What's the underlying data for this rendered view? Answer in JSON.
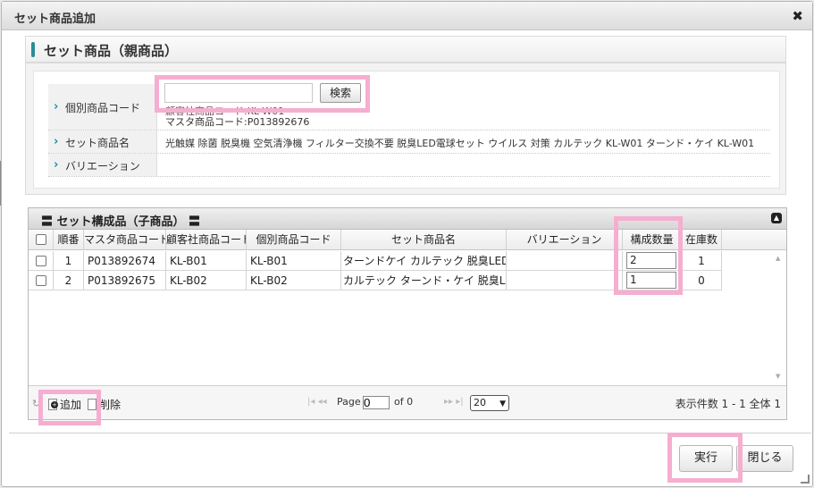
{
  "dialog": {
    "title": "セット商品追加",
    "close_glyph": "✖"
  },
  "parent": {
    "title": "セット商品（親商品）",
    "rows": [
      {
        "label": "個別商品コード",
        "value1": "顧客社商品コード:KL-W01",
        "value2": "マスタ商品コード:P013892676"
      },
      {
        "label": "セット商品名",
        "value": "光触媒 除菌 脱臭機 空気清浄機 フィルター交換不要 脱臭LED電球セット ウイルス 対策 カルテック KL-W01 ターンド・ケイ KL-W01"
      },
      {
        "label": "バリエーション",
        "value": ""
      }
    ],
    "search_button": "検索",
    "search_value": ""
  },
  "child": {
    "title": "〓 セット構成品（子商品） 〓",
    "columns": [
      "順番",
      "マスタ商品コード",
      "顧客社商品コード",
      "個別商品コード",
      "セット商品名",
      "バリエーション",
      "構成数量",
      "在庫数"
    ],
    "rows": [
      {
        "no": "1",
        "master": "P013892674",
        "customer": "KL-B01",
        "item": "KL-B01",
        "name": "ターンドケイ カルテック 脱臭LED電球",
        "variation": "",
        "qty": "2",
        "stock": "1"
      },
      {
        "no": "2",
        "master": "P013892675",
        "customer": "KL-B02",
        "item": "KL-B02",
        "name": "カルテック ターンド・ケイ 脱臭LED電球",
        "variation": "",
        "qty": "1",
        "stock": "0"
      }
    ],
    "pager": {
      "add_label": "追加",
      "delete_label": "削除",
      "page_label": "Page",
      "page_value": "0",
      "of_label": "of 0",
      "page_size": "20",
      "info": "表示件数 1 - 1 全体 1"
    }
  },
  "footer": {
    "execute": "実行",
    "close": "閉じる"
  },
  "colors": {
    "accent": "#2a8c96",
    "highlight": "#f6aed0"
  }
}
